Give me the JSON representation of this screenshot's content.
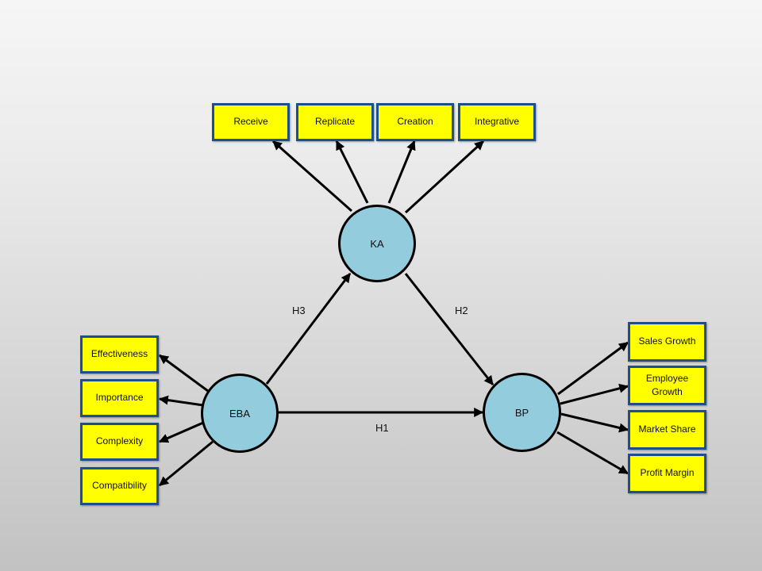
{
  "constructs": {
    "ka": {
      "label": "KA"
    },
    "eba": {
      "label": "EBA"
    },
    "bp": {
      "label": "BP"
    }
  },
  "indicators": {
    "ka": [
      "Receive",
      "Replicate",
      "Creation",
      "Integrative"
    ],
    "eba": [
      "Effectiveness",
      "Importance",
      "Complexity",
      "Compatibility"
    ],
    "bp": [
      "Sales Growth",
      "Employee Growth",
      "Market Share",
      "Profit Margin"
    ]
  },
  "hypotheses": {
    "h1": {
      "label": "H1",
      "from": "EBA",
      "to": "BP"
    },
    "h2": {
      "label": "H2",
      "from": "KA",
      "to": "BP"
    },
    "h3": {
      "label": "H3",
      "from": "EBA",
      "to": "KA"
    }
  },
  "colors": {
    "indicator_fill": "#ffff00",
    "indicator_border": "#1f4e8c",
    "construct_fill": "#93cddd",
    "arrow": "#000000"
  }
}
